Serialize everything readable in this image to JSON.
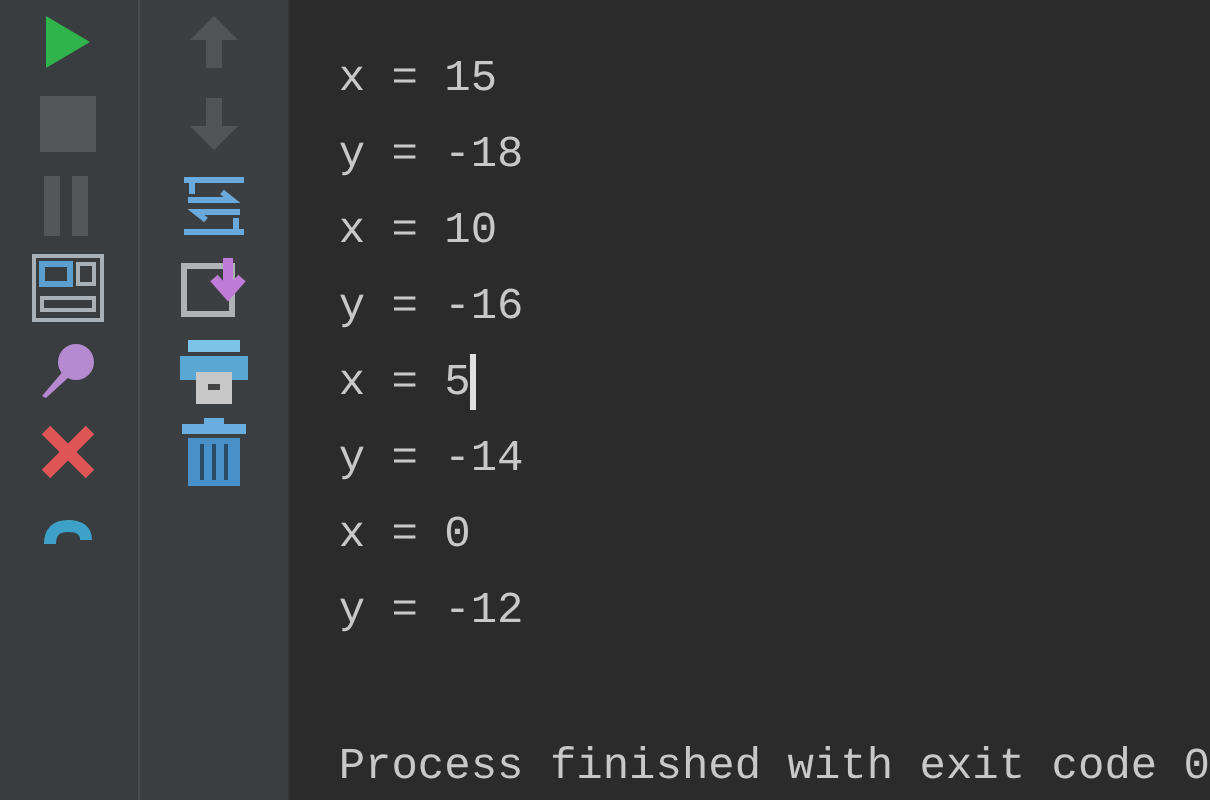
{
  "run_toolbar": [
    {
      "kind": "run",
      "disabled": false
    },
    {
      "kind": "stop",
      "disabled": true
    },
    {
      "kind": "pause",
      "disabled": true
    },
    {
      "kind": "layout",
      "disabled": false
    },
    {
      "kind": "pin",
      "disabled": false
    },
    {
      "kind": "close",
      "disabled": false
    },
    {
      "kind": "help",
      "disabled": false
    }
  ],
  "console_toolbar": [
    {
      "kind": "up",
      "disabled": true
    },
    {
      "kind": "down",
      "disabled": true
    },
    {
      "kind": "wrap",
      "disabled": false
    },
    {
      "kind": "scroll",
      "disabled": false
    },
    {
      "kind": "print",
      "disabled": false
    },
    {
      "kind": "trash",
      "disabled": false
    }
  ],
  "console": {
    "lines": [
      {
        "text": "x = 15",
        "cursor": false
      },
      {
        "text": "y = -18",
        "cursor": false
      },
      {
        "text": "x = 10",
        "cursor": false
      },
      {
        "text": "y = -16",
        "cursor": false
      },
      {
        "text": "x = 5",
        "cursor": true
      },
      {
        "text": "y = -14",
        "cursor": false
      },
      {
        "text": "x = 0",
        "cursor": false
      },
      {
        "text": "y = -12",
        "cursor": false
      }
    ],
    "exit_message": "Process finished with exit code 0"
  }
}
